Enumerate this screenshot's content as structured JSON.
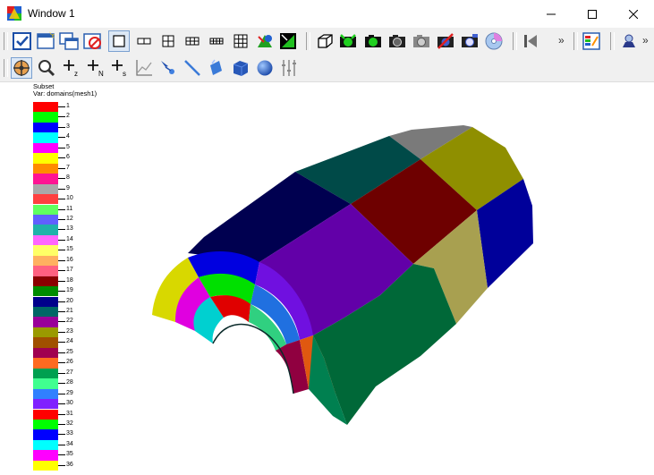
{
  "window": {
    "title": "Window 1",
    "app_icon": "visit-app-icon",
    "controls": [
      "minimize-icon",
      "maximize-icon",
      "close-icon"
    ]
  },
  "toolbar_top": {
    "overflow_label": "»",
    "groups": [
      [
        "apply-checkbox-icon",
        "new-window-icon",
        "copy-window-icon",
        "delete-window-icon"
      ],
      [
        "layout-1x1-icon",
        "layout-1x2-icon",
        "layout-2x2-icon",
        "layout-2x3-icon",
        "layout-2x4-icon",
        "layout-3x3-icon"
      ],
      [
        "lock-view-icon",
        "spin-icon"
      ],
      [
        "reset-view-icon",
        "camera-green-1-icon",
        "camera-green-2-icon",
        "camera-black-icon",
        "camera-gray-icon",
        "camera-red-icon",
        "camera-blue-icon",
        "cd-icon"
      ],
      [
        "play-back-icon"
      ],
      [
        "palette-icon"
      ],
      [
        "fountain-icon"
      ]
    ]
  },
  "toolbar_bottom": {
    "tools": [
      "navigate-icon",
      "zoom-icon",
      "pick-zone-icon",
      "pick-node-icon",
      "pick-spreadsheet-icon",
      "lineout-icon",
      "select-point-icon",
      "line-tool-icon",
      "plane-tool-icon",
      "box-tool-icon",
      "sphere-tool-icon",
      "axis-array-icon"
    ]
  },
  "legend": {
    "title": "Subset",
    "variable": "Var: domains(mesh1)",
    "entries": [
      {
        "label": "1",
        "color": "#ff0000"
      },
      {
        "label": "2",
        "color": "#00ff00"
      },
      {
        "label": "3",
        "color": "#0000ff"
      },
      {
        "label": "4",
        "color": "#00ffff"
      },
      {
        "label": "5",
        "color": "#ff00ff"
      },
      {
        "label": "6",
        "color": "#ffff00"
      },
      {
        "label": "7",
        "color": "#ff8c00"
      },
      {
        "label": "8",
        "color": "#ff1493"
      },
      {
        "label": "9",
        "color": "#a9a9a9"
      },
      {
        "label": "10",
        "color": "#ff4040"
      },
      {
        "label": "11",
        "color": "#60ff60"
      },
      {
        "label": "12",
        "color": "#6060ff"
      },
      {
        "label": "13",
        "color": "#20b2aa"
      },
      {
        "label": "14",
        "color": "#ff66ff"
      },
      {
        "label": "15",
        "color": "#ffff66"
      },
      {
        "label": "16",
        "color": "#ffb060"
      },
      {
        "label": "17",
        "color": "#ff6080"
      },
      {
        "label": "18",
        "color": "#8b0000"
      },
      {
        "label": "19",
        "color": "#008b00"
      },
      {
        "label": "20",
        "color": "#00008b"
      },
      {
        "label": "21",
        "color": "#006666"
      },
      {
        "label": "22",
        "color": "#990099"
      },
      {
        "label": "23",
        "color": "#9a9a00"
      },
      {
        "label": "24",
        "color": "#a05000"
      },
      {
        "label": "25",
        "color": "#a00050"
      },
      {
        "label": "26",
        "color": "#ff6a20"
      },
      {
        "label": "27",
        "color": "#00a050"
      },
      {
        "label": "28",
        "color": "#40ff90"
      },
      {
        "label": "29",
        "color": "#3080ff"
      },
      {
        "label": "30",
        "color": "#8020ff"
      },
      {
        "label": "31",
        "color": "#ff0000"
      },
      {
        "label": "32",
        "color": "#00ff00"
      },
      {
        "label": "33",
        "color": "#0000ff"
      },
      {
        "label": "34",
        "color": "#00ffff"
      },
      {
        "label": "35",
        "color": "#ff00ff"
      },
      {
        "label": "36",
        "color": "#ffff00"
      }
    ]
  },
  "mesh_faces": [
    {
      "name": "top-strip-gray",
      "color": "#7a7a7a"
    },
    {
      "name": "top-strip-teal",
      "color": "#004a48"
    },
    {
      "name": "top-strip-navy",
      "color": "#000050"
    },
    {
      "name": "upper-yellow",
      "color": "#8f8f00"
    },
    {
      "name": "upper-darkred",
      "color": "#6e0000"
    },
    {
      "name": "upper-purple",
      "color": "#6200a8"
    },
    {
      "name": "upper-blue",
      "color": "#000090"
    },
    {
      "name": "mid-khaki",
      "color": "#a8a050"
    },
    {
      "name": "mid-navy",
      "color": "#00009a"
    },
    {
      "name": "lower-green",
      "color": "#006838"
    },
    {
      "name": "end-face-segments",
      "color": "#0000e0"
    }
  ]
}
